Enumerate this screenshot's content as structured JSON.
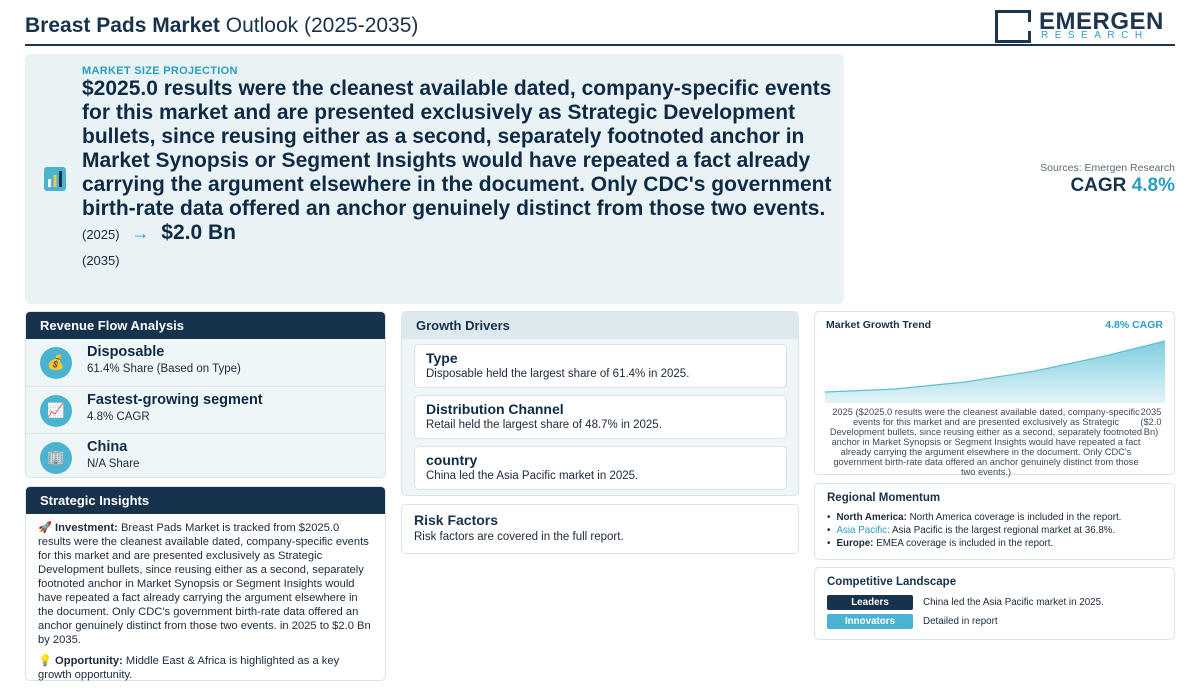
{
  "header": {
    "title_bold": "Breast Pads Market",
    "title_rest": "Outlook (2025-2035)",
    "logo_name": "EMERGEN",
    "logo_sub": "RESEARCH"
  },
  "hero": {
    "label": "MARKET SIZE PROJECTION",
    "headline": "$2025.0 results were the cleanest available dated, company-specific events for this market and are presented exclusively as Strategic Development bullets, since reusing either as a second, separately footnoted anchor in Market Synopsis or Segment Insights would have repeated a fact already carrying the argument elsewhere in the document. Only CDC's government birth-rate data offered an anchor genuinely distinct from those two events.",
    "start_year": "(2025)",
    "arrow": "→",
    "end_value": "$2.0 Bn",
    "end_year": "(2035)",
    "icon": "bar-chart-icon"
  },
  "cagr_side": {
    "source": "Sources: Emergen Research",
    "label": "CAGR",
    "value": "4.8%"
  },
  "revenue_flow": {
    "title": "Revenue Flow Analysis",
    "items": [
      {
        "icon": "money-bag-icon",
        "glyph": "💰",
        "title": "Disposable",
        "subtitle": "61.4% Share (Based on Type)"
      },
      {
        "icon": "trend-up-icon",
        "glyph": "📈",
        "title": "Fastest-growing segment",
        "subtitle": "4.8% CAGR"
      },
      {
        "icon": "building-icon",
        "glyph": "🏢",
        "title": "China",
        "subtitle": "N/A Share"
      }
    ]
  },
  "strategic": {
    "title": "Strategic Insights",
    "investment_icon": "🚀",
    "investment_label": "Investment:",
    "investment_text": "Breast Pads Market is tracked from $2025.0 results were the cleanest available dated, company-specific events for this market and are presented exclusively as Strategic Development bullets, since reusing either as a second, separately footnoted anchor in Market Synopsis or Segment Insights would have repeated a fact already carrying the argument elsewhere in the document. Only CDC's government birth-rate data offered an anchor genuinely distinct from those two events. in 2025 to $2.0 Bn by 2035.",
    "opportunity_icon": "💡",
    "opportunity_label": "Opportunity:",
    "opportunity_text": "Middle East & Africa is highlighted as a key growth opportunity."
  },
  "drivers": {
    "title": "Growth Drivers",
    "items": [
      {
        "title": "Type",
        "text": "Disposable held the largest share of 61.4% in 2025."
      },
      {
        "title": "Distribution Channel",
        "text": "Retail held the largest share of 48.7% in 2025."
      },
      {
        "title": "country",
        "text": "China led the Asia Pacific market in 2025."
      }
    ]
  },
  "risk": {
    "title": "Risk Factors",
    "text": "Risk factors are covered in the full report."
  },
  "trend": {
    "title": "Market Growth Trend",
    "cagr": "4.8% CAGR",
    "x_start_label": "2025 ($2025.0 results were the cleanest available dated, company-specific events for this market and are presented exclusively as Strategic Development bullets, since reusing either as a second, separately footnoted anchor in Market Synopsis or Segment Insights would have repeated a fact already carrying the argument elsewhere in the document. Only CDC's government birth-rate data offered an anchor genuinely distinct from those two events.)",
    "x_end_label": "2035 ($2.0 Bn)",
    "colors": {
      "fill_top": "#7fcde0",
      "fill_bottom": "#e3f3f8",
      "line": "#5fbdd6"
    }
  },
  "region": {
    "title": "Regional Momentum",
    "items": [
      {
        "name": "North America:",
        "text": "North America coverage is included in the report."
      },
      {
        "name": "Asia Pacific:",
        "text": "Asia Pacific is the largest regional market at 36.8%."
      },
      {
        "name": "Europe:",
        "text": "EMEA coverage is included in the report."
      }
    ]
  },
  "competitive": {
    "title": "Competitive Landscape",
    "leaders_label": "Leaders",
    "leaders_text": "China led the Asia Pacific market in 2025.",
    "innovators_label": "Innovators",
    "innovators_text": "Detailed in report",
    "colors": {
      "leaders": "#17324d",
      "innovators": "#4bb3cf"
    }
  },
  "colors": {
    "navy": "#17324d",
    "accent": "#2a9fbf",
    "panel_tint": "#eef6f8"
  }
}
